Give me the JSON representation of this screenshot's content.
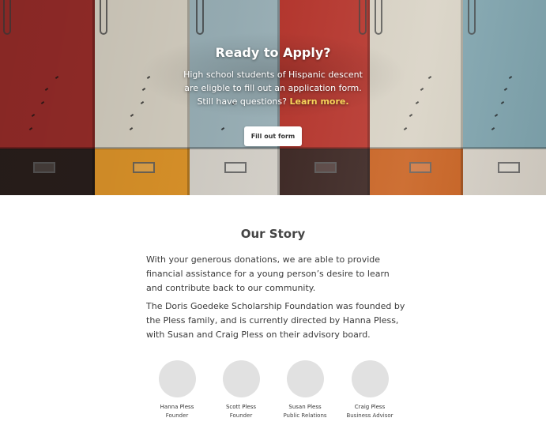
{
  "hero": {
    "title": "Ready to Apply?",
    "text": "High school students of Hispanic descent are eligble to fill out an application form. Still have questions?",
    "link_label": "Learn more.",
    "cta_label": "Fill out form",
    "image_alt": "locker-photo"
  },
  "story": {
    "title": "Our Story",
    "paragraphs": [
      "With your generous donations, we are able to provide financial assistance for a young person’s desire to learn and contribute back to our community.",
      "The Doris Goedeke Scholarship Foundation was founded by the Pless family, and is currently directed by Hanna Pless, with Susan and Craig Pless on their advisory board."
    ]
  },
  "team": [
    {
      "name": "Hanna Pless",
      "role": "Founder"
    },
    {
      "name": "Scott Pless",
      "role": "Founder"
    },
    {
      "name": "Susan Pless",
      "role": "Public Relations"
    },
    {
      "name": "Craig Pless",
      "role": "Business Advisor"
    }
  ],
  "colors": {
    "accent_link": "#f7d45a",
    "avatar_placeholder": "#e1e1e1"
  }
}
